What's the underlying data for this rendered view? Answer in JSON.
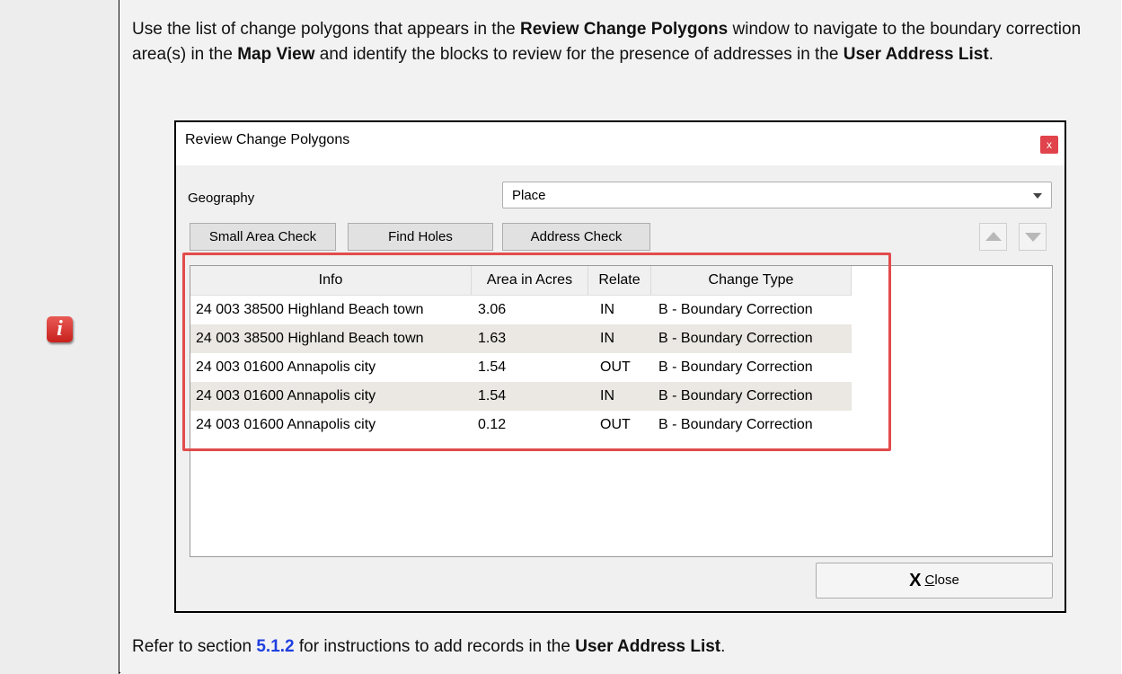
{
  "document": {
    "intro_prefix": "Use the list of change polygons that appears in the ",
    "intro_b1": "Review Change Polygons",
    "intro_mid1": " window to navigate to the boundary correction area(s) in the ",
    "intro_b2": "Map View",
    "intro_mid2": " and identify the blocks to review for the presence of addresses in the ",
    "intro_b3": "User Address List",
    "intro_end": ".",
    "refer_prefix": "Refer to section ",
    "refer_link": "5.1.2",
    "refer_mid": " for instructions to add records in the ",
    "refer_b": "User Address List",
    "refer_end": ".",
    "info_icon_glyph": "i"
  },
  "dialog": {
    "title": "Review Change Polygons",
    "close_glyph": "x",
    "geography_label": "Geography",
    "geography_value": "Place",
    "buttons": {
      "small_area": "Small Area Check",
      "find_holes": "Find Holes",
      "address_check": "Address Check"
    },
    "columns": [
      "Info",
      "Area in Acres",
      "Relate",
      "Change Type"
    ],
    "rows": [
      {
        "info": "24 003 38500 Highland Beach town",
        "area": "3.06",
        "relate": "IN",
        "change": "B - Boundary Correction"
      },
      {
        "info": "24 003 38500 Highland Beach town",
        "area": "1.63",
        "relate": "IN",
        "change": "B - Boundary Correction"
      },
      {
        "info": "24 003 01600 Annapolis city",
        "area": "1.54",
        "relate": "OUT",
        "change": "B - Boundary Correction"
      },
      {
        "info": "24 003 01600 Annapolis city",
        "area": "1.54",
        "relate": "IN",
        "change": "B - Boundary Correction"
      },
      {
        "info": "24 003 01600 Annapolis city",
        "area": "0.12",
        "relate": "OUT",
        "change": "B - Boundary Correction"
      }
    ],
    "close_button": {
      "mnemonic": "C",
      "rest": "lose",
      "icon": "X"
    }
  },
  "colors": {
    "highlight": "#e34b4b",
    "link": "#1f3fe0",
    "info_icon": "#d2302c"
  }
}
